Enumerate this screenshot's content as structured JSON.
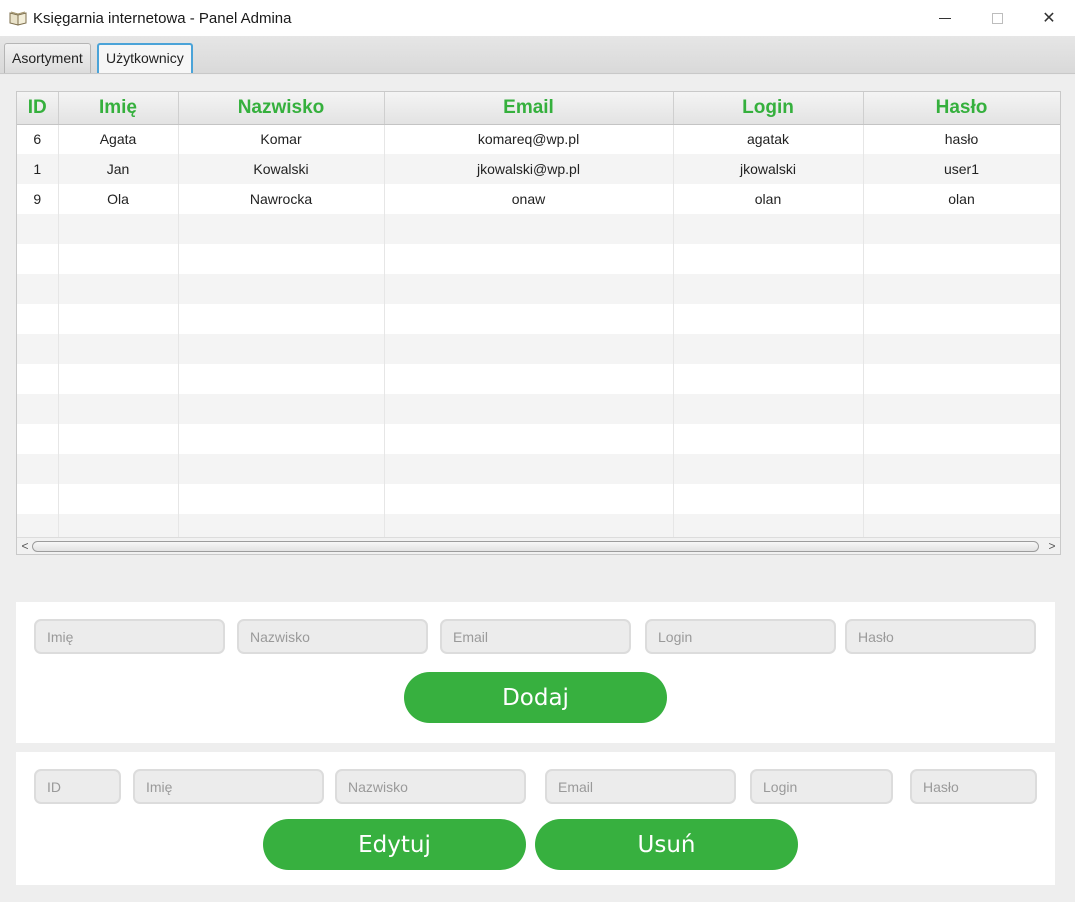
{
  "window": {
    "title": "Księgarnia internetowa - Panel Admina",
    "controls": {
      "minimize": "—",
      "maximize": "",
      "close": "✕"
    }
  },
  "tabs": [
    {
      "label": "Asortyment",
      "active": false
    },
    {
      "label": "Użytkownicy",
      "active": true
    }
  ],
  "table": {
    "headers": [
      "ID",
      "Imię",
      "Nazwisko",
      "Email",
      "Login",
      "Hasło"
    ],
    "rows": [
      [
        "6",
        "Agata",
        "Komar",
        "komareq@wp.pl",
        "agatak",
        "hasło"
      ],
      [
        "1",
        "Jan",
        "Kowalski",
        "jkowalski@wp.pl",
        "jkowalski",
        "user1"
      ],
      [
        "9",
        "Ola",
        "Nawrocka",
        "onaw",
        "olan",
        "olan"
      ]
    ],
    "scroll": {
      "left_arrow": "<",
      "right_arrow": ">"
    }
  },
  "add_form": {
    "placeholders": {
      "imie": "Imię",
      "nazwisko": "Nazwisko",
      "email": "Email",
      "login": "Login",
      "haslo": "Hasło"
    },
    "add_label": "Dodaj"
  },
  "edit_form": {
    "placeholders": {
      "id": "ID",
      "imie": "Imię",
      "nazwisko": "Nazwisko",
      "email": "Email",
      "login": "Login",
      "haslo": "Hasło"
    },
    "edit_label": "Edytuj",
    "delete_label": "Usuń"
  },
  "colors": {
    "accent_green": "#37b03f",
    "header_text_green": "#35b03d",
    "active_tab_border": "#4aa3d8"
  },
  "icons": {
    "app": "book-icon",
    "minimize": "minimize-icon",
    "maximize": "maximize-icon",
    "close": "close-icon"
  }
}
